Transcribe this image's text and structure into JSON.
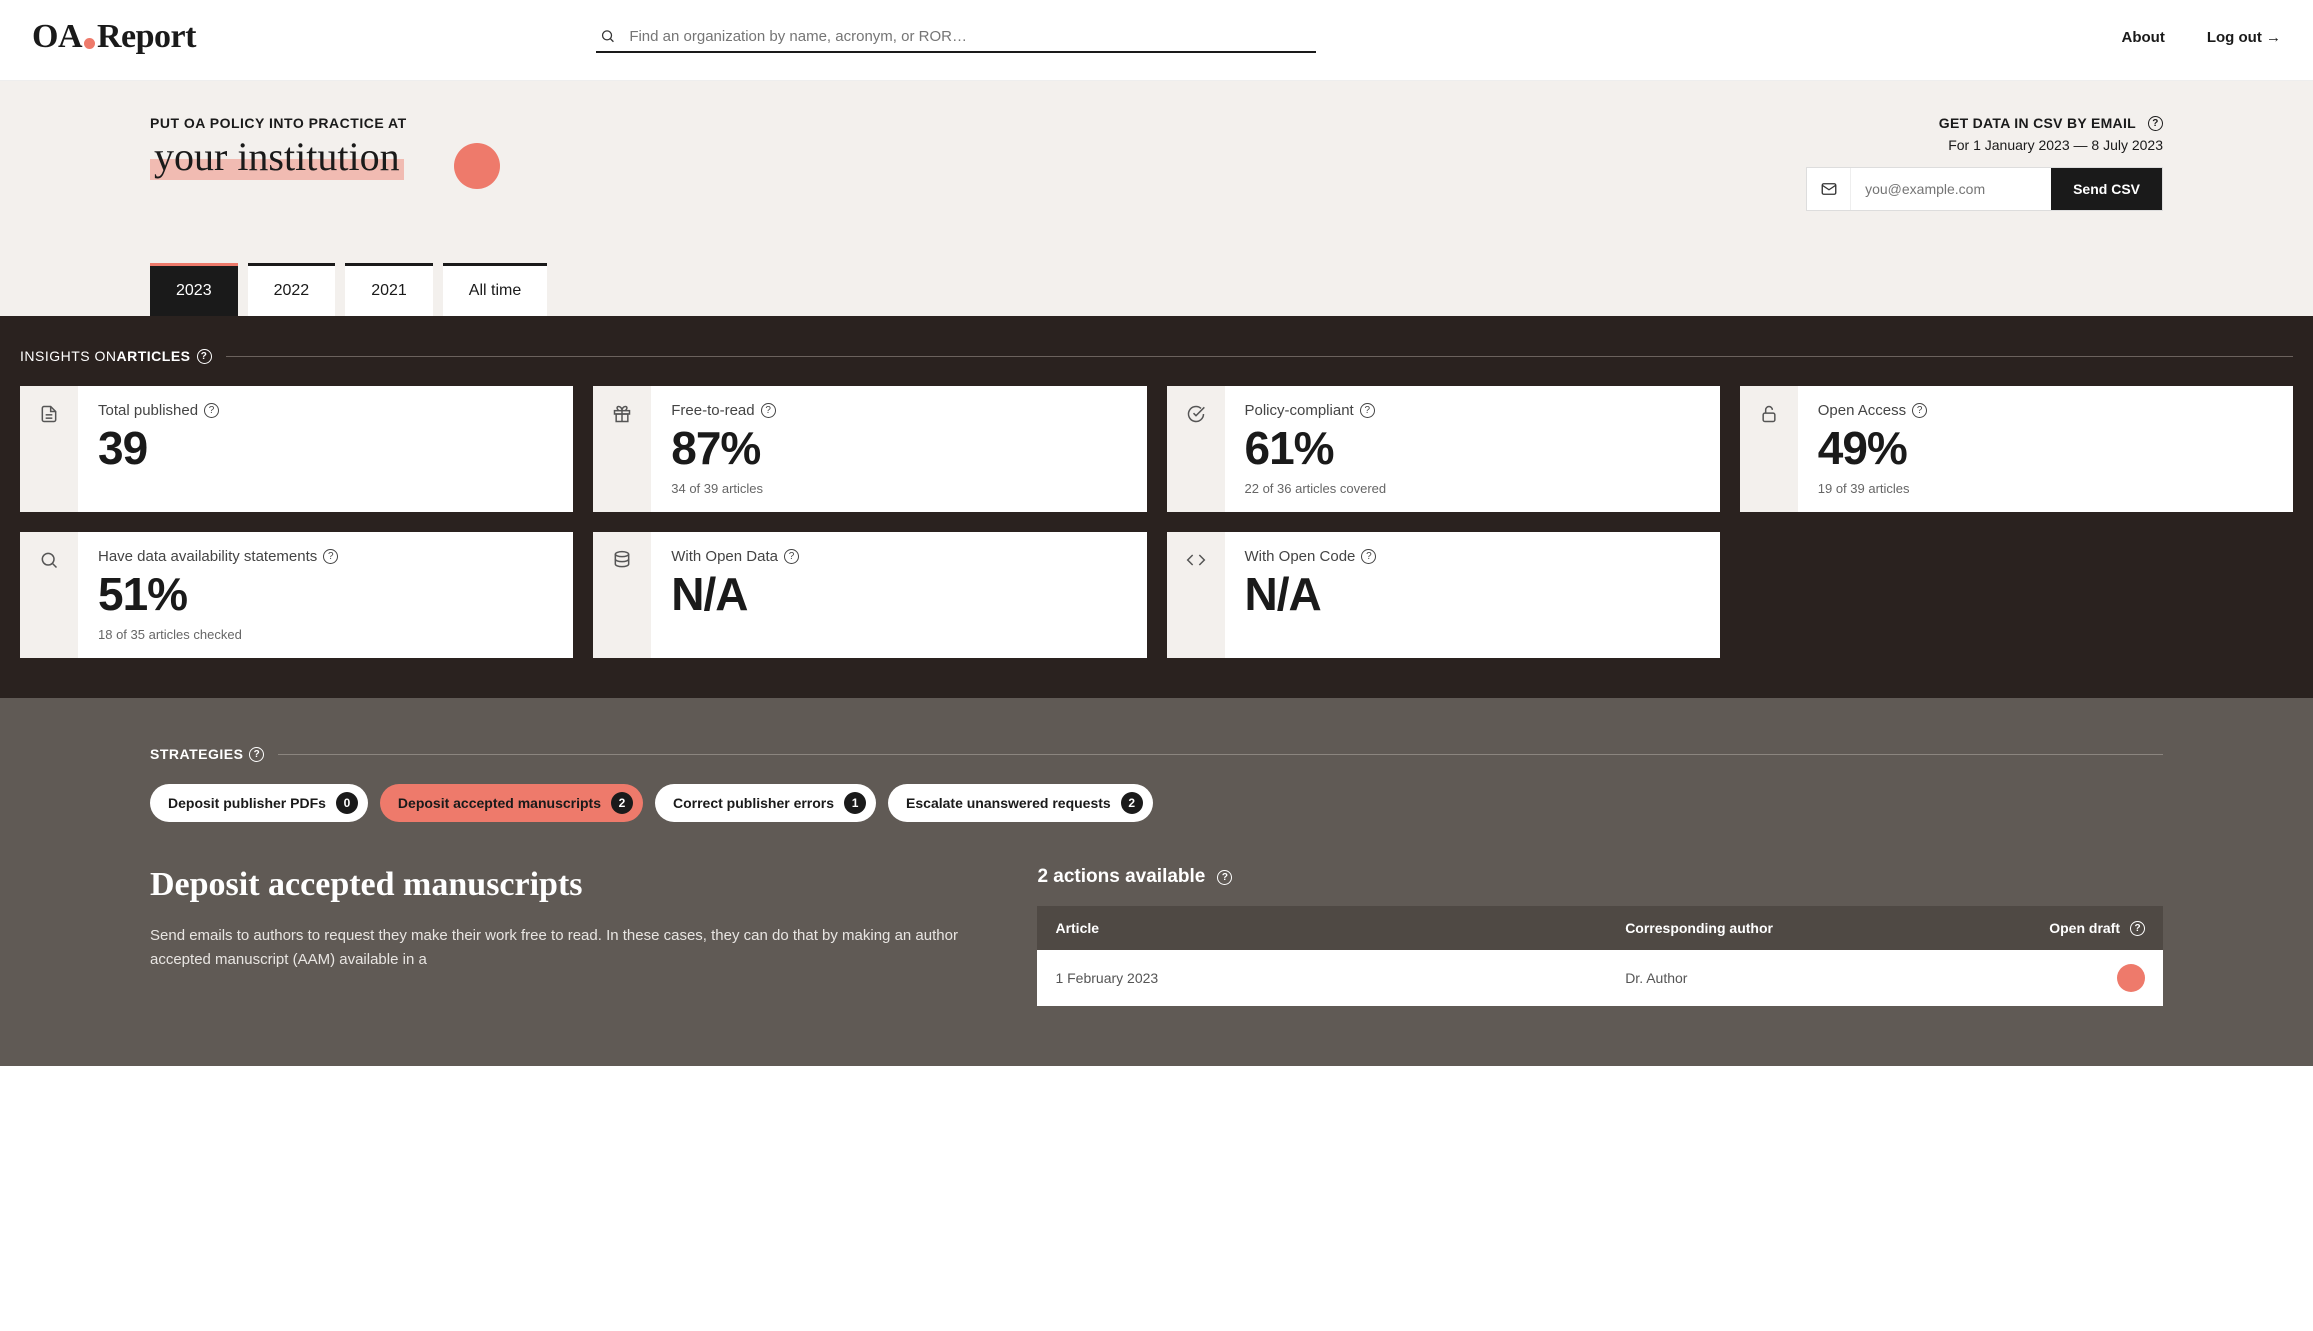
{
  "header": {
    "logo_left": "OA",
    "logo_right": "Report",
    "search_placeholder": "Find an organization by name, acronym, or ROR…",
    "nav": {
      "about": "About",
      "logout": "Log out →"
    }
  },
  "hero": {
    "kicker": "PUT OA POLICY INTO PRACTICE AT",
    "title": "your institution",
    "csv": {
      "label": "GET DATA IN CSV BY EMAIL",
      "date_range": "For 1 January 2023 — 8 July 2023",
      "email_placeholder": "you@example.com",
      "send_btn": "Send CSV"
    },
    "tabs": [
      "2023",
      "2022",
      "2021",
      "All time"
    ],
    "active_tab": 0
  },
  "insights": {
    "heading_thin": "INSIGHTS ON ",
    "heading_bold": "ARTICLES",
    "cards": [
      {
        "icon": "file",
        "label": "Total published",
        "value": "39",
        "sub": ""
      },
      {
        "icon": "gift",
        "label": "Free-to-read",
        "value": "87%",
        "sub": "34 of 39 articles"
      },
      {
        "icon": "check-circle",
        "label": "Policy-compliant",
        "value": "61%",
        "sub": "22 of 36 articles covered"
      },
      {
        "icon": "unlock",
        "label": "Open Access",
        "value": "49%",
        "sub": "19 of 39 articles"
      },
      {
        "icon": "search",
        "label": "Have data availability statements",
        "value": "51%",
        "sub": "18 of 35 articles checked"
      },
      {
        "icon": "database",
        "label": "With Open Data",
        "value": "N/A",
        "sub": ""
      },
      {
        "icon": "code",
        "label": "With Open Code",
        "value": "N/A",
        "sub": ""
      }
    ]
  },
  "strategies": {
    "heading": "STRATEGIES",
    "chips": [
      {
        "label": "Deposit publisher PDFs",
        "count": "0"
      },
      {
        "label": "Deposit accepted manuscripts",
        "count": "2"
      },
      {
        "label": "Correct publisher errors",
        "count": "1"
      },
      {
        "label": "Escalate unanswered requests",
        "count": "2"
      }
    ],
    "active_chip": 1,
    "detail": {
      "title": "Deposit accepted manuscripts",
      "desc": "Send emails to authors to request they make their work free to read. In these cases, they can do that by making an author accepted manuscript (AAM) available in a",
      "actions_head": "2 actions available",
      "columns": {
        "article": "Article",
        "author": "Corresponding author",
        "draft": "Open draft"
      },
      "rows": [
        {
          "date": "1 February 2023",
          "author": "Dr. Author"
        }
      ]
    }
  }
}
